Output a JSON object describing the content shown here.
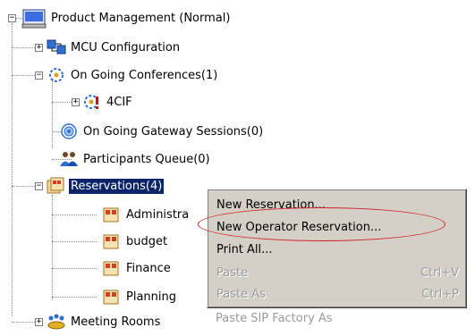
{
  "tree": {
    "root": {
      "label": "Product Management  (Normal)",
      "icon": "computer-icon",
      "expanded": true
    },
    "items": [
      {
        "label": "MCU Configuration",
        "icon": "mcu-config-icon",
        "expander": "+"
      },
      {
        "label": "On Going Conferences(1)",
        "icon": "conferences-icon",
        "expander": "−"
      },
      {
        "label": "4CIF",
        "icon": "conference-alert-icon",
        "expander": "+"
      },
      {
        "label": "On Going Gateway Sessions(0)",
        "icon": "gateway-icon"
      },
      {
        "label": "Participants Queue(0)",
        "icon": "participants-icon"
      },
      {
        "label": "Reservations(4)",
        "icon": "reservations-icon",
        "expander": "−",
        "selected": true
      },
      {
        "label": "Administra",
        "icon": "reservation-doc-icon"
      },
      {
        "label": "budget",
        "icon": "reservation-doc-icon"
      },
      {
        "label": "Finance",
        "icon": "reservation-doc-icon"
      },
      {
        "label": "Planning",
        "icon": "reservation-doc-icon"
      },
      {
        "label": "Meeting Rooms",
        "icon": "meeting-rooms-icon",
        "expander": "+"
      }
    ]
  },
  "context_menu": {
    "items": [
      {
        "label": "New Reservation...",
        "shortcut": "",
        "enabled": true
      },
      {
        "label": "New Operator Reservation...",
        "shortcut": "",
        "enabled": true,
        "highlighted_annotation": true
      },
      {
        "label": "Print All...",
        "shortcut": "",
        "enabled": true
      },
      {
        "label": "Paste",
        "shortcut": "Ctrl+V",
        "enabled": false
      },
      {
        "label": "Paste As",
        "shortcut": "Ctrl+P",
        "enabled": false
      },
      {
        "label": "Paste SIP Factory As",
        "shortcut": "",
        "enabled": false
      }
    ]
  },
  "colors": {
    "selection": "#0a246a",
    "menu_bg": "#d4d0c8",
    "annotation": "#d0242a"
  }
}
